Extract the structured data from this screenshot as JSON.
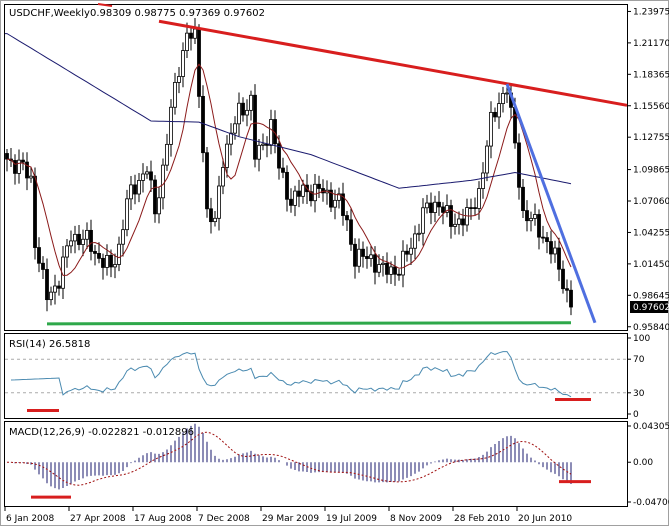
{
  "window": {
    "symbol_label": "USDCHF,Weekly",
    "ohlc_label": "0.98309 0.98775 0.97369 0.97602"
  },
  "colors": {
    "resistance_line": "#d81e1e",
    "falling_trendline": "#4f6fe0",
    "support_line": "#2ea84a",
    "fast_ma": "#8b1a1a",
    "slow_ma": "#1a1a6e",
    "rsi_line": "#4a8ab0",
    "macd_bars": "#1a1a6e",
    "signal_line": "#a01010",
    "marker": "#d81e1e"
  },
  "chart_data": [
    {
      "type": "candlestick",
      "title": "USDCHF,Weekly",
      "ylim": [
        0.9555,
        1.2455
      ],
      "y_ticks": [
        "1.23975",
        "1.21170",
        "1.18365",
        "1.15560",
        "1.12755",
        "1.09865",
        "1.07060",
        "1.04255",
        "1.01450",
        "0.98645",
        "0.95840"
      ],
      "y_tick_values": [
        1.23975,
        1.2117,
        1.18365,
        1.1556,
        1.12755,
        1.09865,
        1.0706,
        1.04255,
        1.0145,
        0.98645,
        0.9584
      ],
      "current_price_label": "0.97602",
      "current_price": 0.97602,
      "x_ticks": [
        "6 Jan 2008",
        "27 Apr 2008",
        "17 Aug 2008",
        "7 Dec 2008",
        "29 Mar 2009",
        "19 Jul 2009",
        "8 Nov 2009",
        "28 Feb 2010",
        "20 Jun 2010"
      ],
      "x_tick_bars": [
        0,
        16,
        32,
        48,
        64,
        80,
        96,
        112,
        128
      ],
      "bar_count": 142,
      "close_keypoints": [
        [
          0,
          1.108
        ],
        [
          4,
          1.1
        ],
        [
          6,
          1.09
        ],
        [
          7,
          1.035
        ],
        [
          9,
          1.0
        ],
        [
          10,
          0.985
        ],
        [
          13,
          1.0
        ],
        [
          16,
          1.04
        ],
        [
          20,
          1.035
        ],
        [
          23,
          1.02
        ],
        [
          26,
          1.01
        ],
        [
          28,
          1.03
        ],
        [
          30,
          1.07
        ],
        [
          33,
          1.09
        ],
        [
          35,
          1.1
        ],
        [
          37,
          1.06
        ],
        [
          39,
          1.1
        ],
        [
          41,
          1.15
        ],
        [
          43,
          1.19
        ],
        [
          45,
          1.22
        ],
        [
          47,
          1.215
        ],
        [
          49,
          1.12
        ],
        [
          50,
          1.06
        ],
        [
          52,
          1.05
        ],
        [
          54,
          1.11
        ],
        [
          58,
          1.15
        ],
        [
          61,
          1.16
        ],
        [
          62,
          1.11
        ],
        [
          64,
          1.12
        ],
        [
          66,
          1.14
        ],
        [
          68,
          1.1
        ],
        [
          71,
          1.07
        ],
        [
          74,
          1.08
        ],
        [
          78,
          1.08
        ],
        [
          83,
          1.07
        ],
        [
          85,
          1.05
        ],
        [
          87,
          1.02
        ],
        [
          91,
          1.02
        ],
        [
          94,
          1.008
        ],
        [
          98,
          1.01
        ],
        [
          101,
          1.03
        ],
        [
          104,
          1.06
        ],
        [
          108,
          1.07
        ],
        [
          111,
          1.05
        ],
        [
          116,
          1.06
        ],
        [
          118,
          1.08
        ],
        [
          121,
          1.14
        ],
        [
          123,
          1.16
        ],
        [
          125,
          1.172
        ],
        [
          127,
          1.12
        ],
        [
          128,
          1.09
        ],
        [
          129,
          1.06
        ],
        [
          132,
          1.05
        ],
        [
          134,
          1.04
        ],
        [
          137,
          1.02
        ],
        [
          139,
          1.0
        ],
        [
          141,
          0.976
        ]
      ],
      "slow_ma_keypoints": [
        [
          0,
          1.22
        ],
        [
          36,
          1.142
        ],
        [
          48,
          1.141
        ],
        [
          58,
          1.128
        ],
        [
          76,
          1.112
        ],
        [
          98,
          1.082
        ],
        [
          116,
          1.089
        ],
        [
          127,
          1.096
        ],
        [
          141,
          1.086
        ]
      ],
      "fast_ma_period": 8,
      "resistance_line": [
        [
          38,
          1.231
        ],
        [
          155,
          1.156
        ]
      ],
      "falling_trendline": [
        [
          125,
          1.175
        ],
        [
          147,
          0.962
        ]
      ],
      "support_line": [
        [
          10,
          0.961
        ],
        [
          141,
          0.962
        ]
      ]
    },
    {
      "type": "line",
      "title": "RSI(14) 26.5818",
      "ylim": [
        0,
        100
      ],
      "y_ticks": [
        "100",
        "70",
        "30",
        "0"
      ],
      "y_tick_values": [
        100,
        70,
        30,
        0
      ],
      "levels": [
        70,
        30
      ],
      "last_value": 26.5818,
      "markers": [
        [
          5,
          13,
          9
        ],
        [
          137,
          146,
          22
        ]
      ]
    },
    {
      "type": "bar",
      "title": "MACD(12,26,9) -0.022821 -0.012896",
      "ylim": [
        -0.0495,
        0.0455
      ],
      "y_ticks": [
        "0.043057",
        "0.00",
        "-0.04706"
      ],
      "y_tick_values": [
        0.043057,
        0,
        -0.04706
      ],
      "macd_last": -0.022821,
      "signal_last": -0.012896,
      "params": [
        12,
        26,
        9
      ],
      "markers": [
        [
          6,
          16,
          -0.0395
        ],
        [
          138,
          146,
          -0.022
        ]
      ]
    }
  ]
}
